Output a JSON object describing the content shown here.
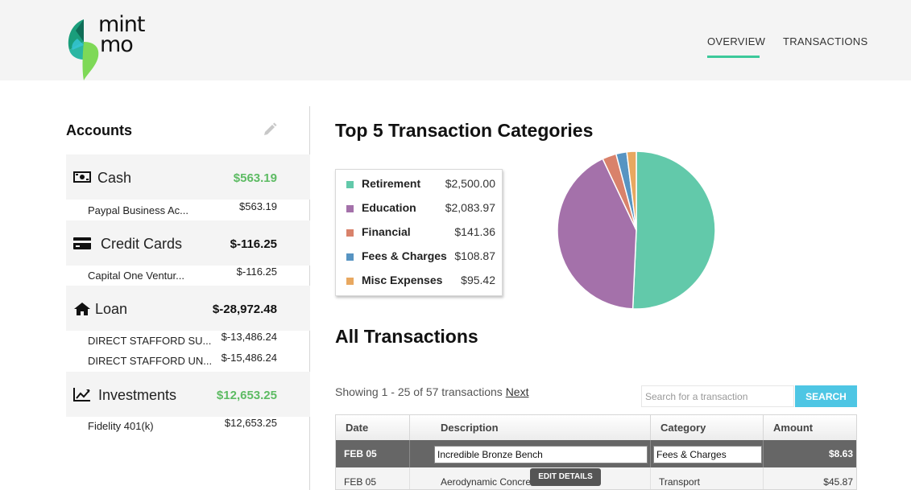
{
  "header": {
    "logo": {
      "line1": "mint",
      "line2": "mo"
    },
    "nav": [
      {
        "label": "OVERVIEW",
        "active": true
      },
      {
        "label": "TRANSACTIONS",
        "active": false
      }
    ],
    "accent_color": "#3cc99a"
  },
  "accounts": {
    "title": "Accounts",
    "edit_icon": "pencil-icon",
    "groups": [
      {
        "name": "Cash",
        "icon": "money-icon",
        "total": "$563.19",
        "total_color": "green",
        "items": [
          {
            "name": "Paypal Business Ac...",
            "amount": "$563.19"
          }
        ]
      },
      {
        "name": "Credit Cards",
        "icon": "credit-card-icon",
        "total": "$-116.25",
        "total_color": "black",
        "items": [
          {
            "name": "Capital One Ventur...",
            "amount": "$-116.25"
          }
        ]
      },
      {
        "name": "Loan",
        "icon": "home-icon",
        "total": "$-28,972.48",
        "total_color": "black",
        "items": [
          {
            "name": "DIRECT STAFFORD SU...",
            "amount": "$-13,486.24"
          },
          {
            "name": "DIRECT STAFFORD UN...",
            "amount": "$-15,486.24"
          }
        ]
      },
      {
        "name": "Investments",
        "icon": "line-chart-icon",
        "total": "$12,653.25",
        "total_color": "green",
        "items": [
          {
            "name": "Fidelity 401(k)",
            "amount": "$12,653.25"
          }
        ]
      }
    ]
  },
  "categories": {
    "title": "Top 5 Transaction Categories"
  },
  "chart_data": {
    "type": "pie",
    "title": "Top 5 Transaction Categories",
    "labels": [
      "Retirement",
      "Education",
      "Financial",
      "Fees & Charges",
      "Misc Expenses"
    ],
    "values": [
      2500.0,
      2083.97,
      141.36,
      108.87,
      95.42
    ],
    "value_labels": [
      "$2,500.00",
      "$2,083.97",
      "$141.36",
      "$108.87",
      "$95.42"
    ],
    "colors": [
      "#62c9aa",
      "#a471aa",
      "#d9826b",
      "#5794c2",
      "#e8a860"
    ],
    "legend": "left"
  },
  "transactions": {
    "title": "All Transactions",
    "showing": "Showing 1 - 25 of 57 transactions",
    "next_label": "Next",
    "search_placeholder": "Search for a transaction",
    "search_button": "SEARCH",
    "columns": [
      "Date",
      "Description",
      "Category",
      "Amount"
    ],
    "rows": [
      {
        "date": "FEB 05",
        "description": "Incredible Bronze Bench",
        "category": "Fees & Charges",
        "amount": "$8.63",
        "selected": true
      },
      {
        "date": "FEB 05",
        "description": "Aerodynamic Concre",
        "category": "Transport",
        "amount": "$45.87",
        "selected": false
      }
    ],
    "edit_details": "EDIT DETAILS"
  }
}
